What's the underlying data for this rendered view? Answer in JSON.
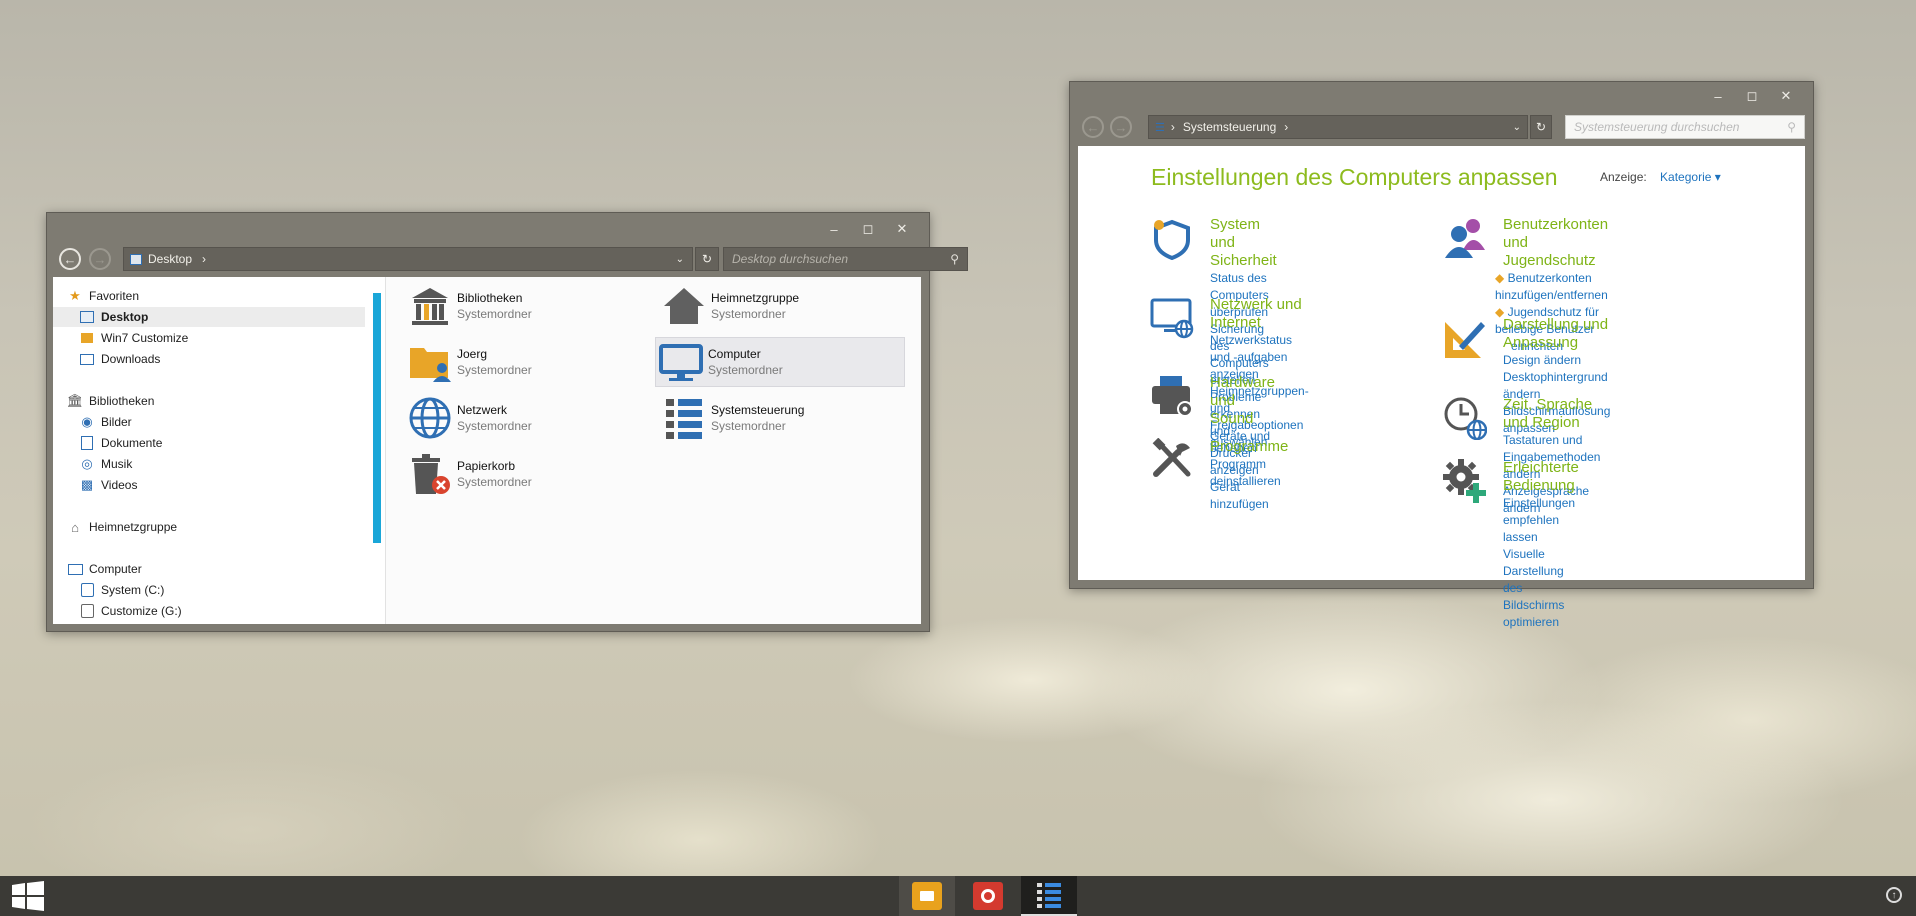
{
  "explorer": {
    "address": "Desktop",
    "search_placeholder": "Desktop durchsuchen",
    "nav": {
      "favorites": "Favoriten",
      "desktop": "Desktop",
      "win7": "Win7 Customize",
      "downloads": "Downloads",
      "libraries": "Bibliotheken",
      "pictures": "Bilder",
      "documents": "Dokumente",
      "music": "Musik",
      "videos": "Videos",
      "homegroup": "Heimnetzgruppe",
      "computer": "Computer",
      "drive_c": "System (C:)",
      "drive_g": "Customize (G:)"
    },
    "items": [
      {
        "name": "Bibliotheken",
        "type": "Systemordner"
      },
      {
        "name": "Heimnetzgruppe",
        "type": "Systemordner"
      },
      {
        "name": "Joerg",
        "type": "Systemordner"
      },
      {
        "name": "Computer",
        "type": "Systemordner"
      },
      {
        "name": "Netzwerk",
        "type": "Systemordner"
      },
      {
        "name": "Systemsteuerung",
        "type": "Systemordner"
      },
      {
        "name": "Papierkorb",
        "type": "Systemordner"
      }
    ]
  },
  "control_panel": {
    "address": "Systemsteuerung",
    "search_placeholder": "Systemsteuerung durchsuchen",
    "heading": "Einstellungen des Computers anpassen",
    "view_label": "Anzeige:",
    "view_value": "Kategorie",
    "categories": [
      {
        "title": "System und Sicherheit",
        "links": [
          "Status des Computers überprüfen",
          "Sicherung des Computers erstellen",
          "Probleme erkennen und beheben"
        ]
      },
      {
        "title": "Netzwerk und Internet",
        "links": [
          "Netzwerkstatus und -aufgaben anzeigen",
          "Heimnetzgruppen- und Freigabeoptionen",
          "auswählen"
        ]
      },
      {
        "title": "Hardware und Sound",
        "links": [
          "Geräte und Drucker anzeigen",
          "Gerät hinzufügen"
        ]
      },
      {
        "title": "Programme",
        "links": [
          "Programm deinstallieren"
        ]
      },
      {
        "title": "Benutzerkonten und",
        "title2": "Jugendschutz",
        "links": [
          "Benutzerkonten hinzufügen/entfernen",
          "Jugendschutz für beliebige Benutzer",
          "einrichten"
        ]
      },
      {
        "title": "Darstellung und Anpassung",
        "links": [
          "Design ändern",
          "Desktophintergrund ändern",
          "Bildschirmauflösung anpassen"
        ]
      },
      {
        "title": "Zeit, Sprache und Region",
        "links": [
          "Tastaturen und Eingabemethoden ändern",
          "Anzeigesprache ändern"
        ]
      },
      {
        "title": "Erleichterte Bedienung",
        "links": [
          "Einstellungen empfehlen lassen",
          "Visuelle Darstellung des Bildschirms",
          "optimieren"
        ]
      }
    ]
  },
  "colors": {
    "accent_green": "#7fb417",
    "link_blue": "#1e73be",
    "nav_accent": "#1aa6d8",
    "icon_blue": "#2f6fb3"
  }
}
